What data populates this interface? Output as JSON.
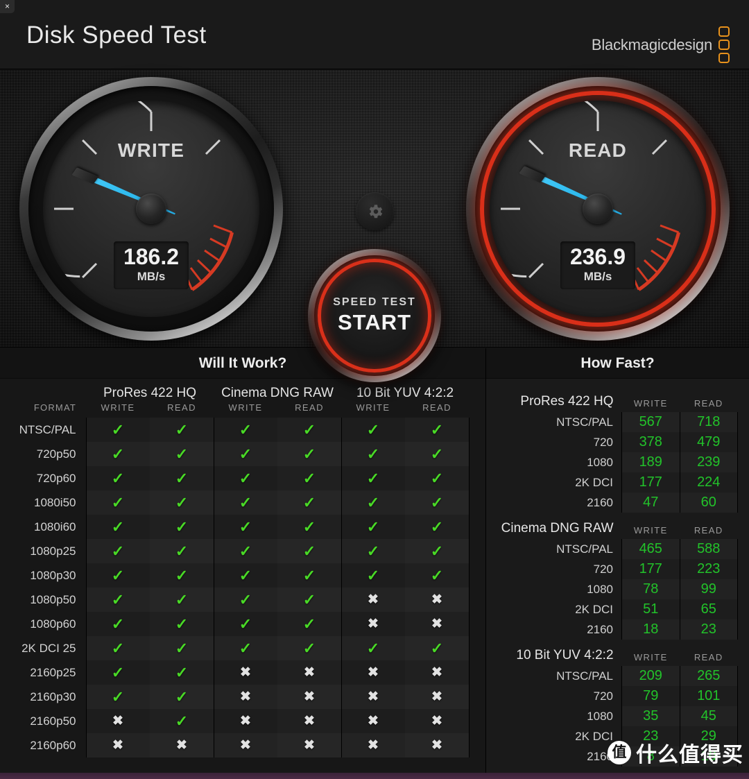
{
  "window": {
    "close_label": "×"
  },
  "header": {
    "title": "Disk Speed Test",
    "brand": "Blackmagicdesign",
    "brand_color": "#e8921c"
  },
  "gauges": {
    "write": {
      "label": "WRITE",
      "value": "186.2",
      "unit": "MB/s",
      "needle_color": "#32bdf0",
      "active": false
    },
    "read": {
      "label": "READ",
      "value": "236.9",
      "unit": "MB/s",
      "needle_color": "#32bdf0",
      "active": true,
      "ring_color": "#d92f19"
    }
  },
  "controls": {
    "gear_icon": "gear-icon",
    "start_line1": "SPEED TEST",
    "start_line2": "START",
    "start_ring_color": "#d9301a"
  },
  "will_it_work": {
    "title": "Will It Work?",
    "format_header": "FORMAT",
    "groups": [
      {
        "name": "ProRes 422 HQ",
        "cols": [
          "WRITE",
          "READ"
        ]
      },
      {
        "name": "Cinema DNG RAW",
        "cols": [
          "WRITE",
          "READ"
        ]
      },
      {
        "name": "10 Bit YUV 4:2:2",
        "cols": [
          "WRITE",
          "READ"
        ]
      }
    ],
    "tick_glyph": "✓",
    "cross_glyph": "✖",
    "tick_color": "#49d926",
    "cross_color": "#e2e2e2",
    "rows": [
      {
        "format": "NTSC/PAL",
        "marks": [
          true,
          true,
          true,
          true,
          true,
          true
        ]
      },
      {
        "format": "720p50",
        "marks": [
          true,
          true,
          true,
          true,
          true,
          true
        ]
      },
      {
        "format": "720p60",
        "marks": [
          true,
          true,
          true,
          true,
          true,
          true
        ]
      },
      {
        "format": "1080i50",
        "marks": [
          true,
          true,
          true,
          true,
          true,
          true
        ]
      },
      {
        "format": "1080i60",
        "marks": [
          true,
          true,
          true,
          true,
          true,
          true
        ]
      },
      {
        "format": "1080p25",
        "marks": [
          true,
          true,
          true,
          true,
          true,
          true
        ]
      },
      {
        "format": "1080p30",
        "marks": [
          true,
          true,
          true,
          true,
          true,
          true
        ]
      },
      {
        "format": "1080p50",
        "marks": [
          true,
          true,
          true,
          true,
          false,
          false
        ]
      },
      {
        "format": "1080p60",
        "marks": [
          true,
          true,
          true,
          true,
          false,
          false
        ]
      },
      {
        "format": "2K DCI 25",
        "marks": [
          true,
          true,
          true,
          true,
          true,
          true
        ]
      },
      {
        "format": "2160p25",
        "marks": [
          true,
          true,
          false,
          false,
          false,
          false
        ]
      },
      {
        "format": "2160p30",
        "marks": [
          true,
          true,
          false,
          false,
          false,
          false
        ]
      },
      {
        "format": "2160p50",
        "marks": [
          false,
          true,
          false,
          false,
          false,
          false
        ]
      },
      {
        "format": "2160p60",
        "marks": [
          false,
          false,
          false,
          false,
          false,
          false
        ]
      }
    ]
  },
  "how_fast": {
    "title": "How Fast?",
    "value_color": "#22c32a",
    "col_write": "WRITE",
    "col_read": "READ",
    "sections": [
      {
        "name": "ProRes 422 HQ",
        "rows": [
          {
            "label": "NTSC/PAL",
            "write": "567",
            "read": "718"
          },
          {
            "label": "720",
            "write": "378",
            "read": "479"
          },
          {
            "label": "1080",
            "write": "189",
            "read": "239"
          },
          {
            "label": "2K DCI",
            "write": "177",
            "read": "224"
          },
          {
            "label": "2160",
            "write": "47",
            "read": "60"
          }
        ]
      },
      {
        "name": "Cinema DNG RAW",
        "rows": [
          {
            "label": "NTSC/PAL",
            "write": "465",
            "read": "588"
          },
          {
            "label": "720",
            "write": "177",
            "read": "223"
          },
          {
            "label": "1080",
            "write": "78",
            "read": "99"
          },
          {
            "label": "2K DCI",
            "write": "51",
            "read": "65"
          },
          {
            "label": "2160",
            "write": "18",
            "read": "23"
          }
        ]
      },
      {
        "name": "10 Bit YUV 4:2:2",
        "rows": [
          {
            "label": "NTSC/PAL",
            "write": "209",
            "read": "265"
          },
          {
            "label": "720",
            "write": "79",
            "read": "101"
          },
          {
            "label": "1080",
            "write": "35",
            "read": "45"
          },
          {
            "label": "2K DCI",
            "write": "23",
            "read": "29"
          },
          {
            "label": "2160",
            "write": "8",
            "read": "10"
          }
        ]
      }
    ]
  },
  "watermark": {
    "logo": "值",
    "text": "什么值得买"
  }
}
